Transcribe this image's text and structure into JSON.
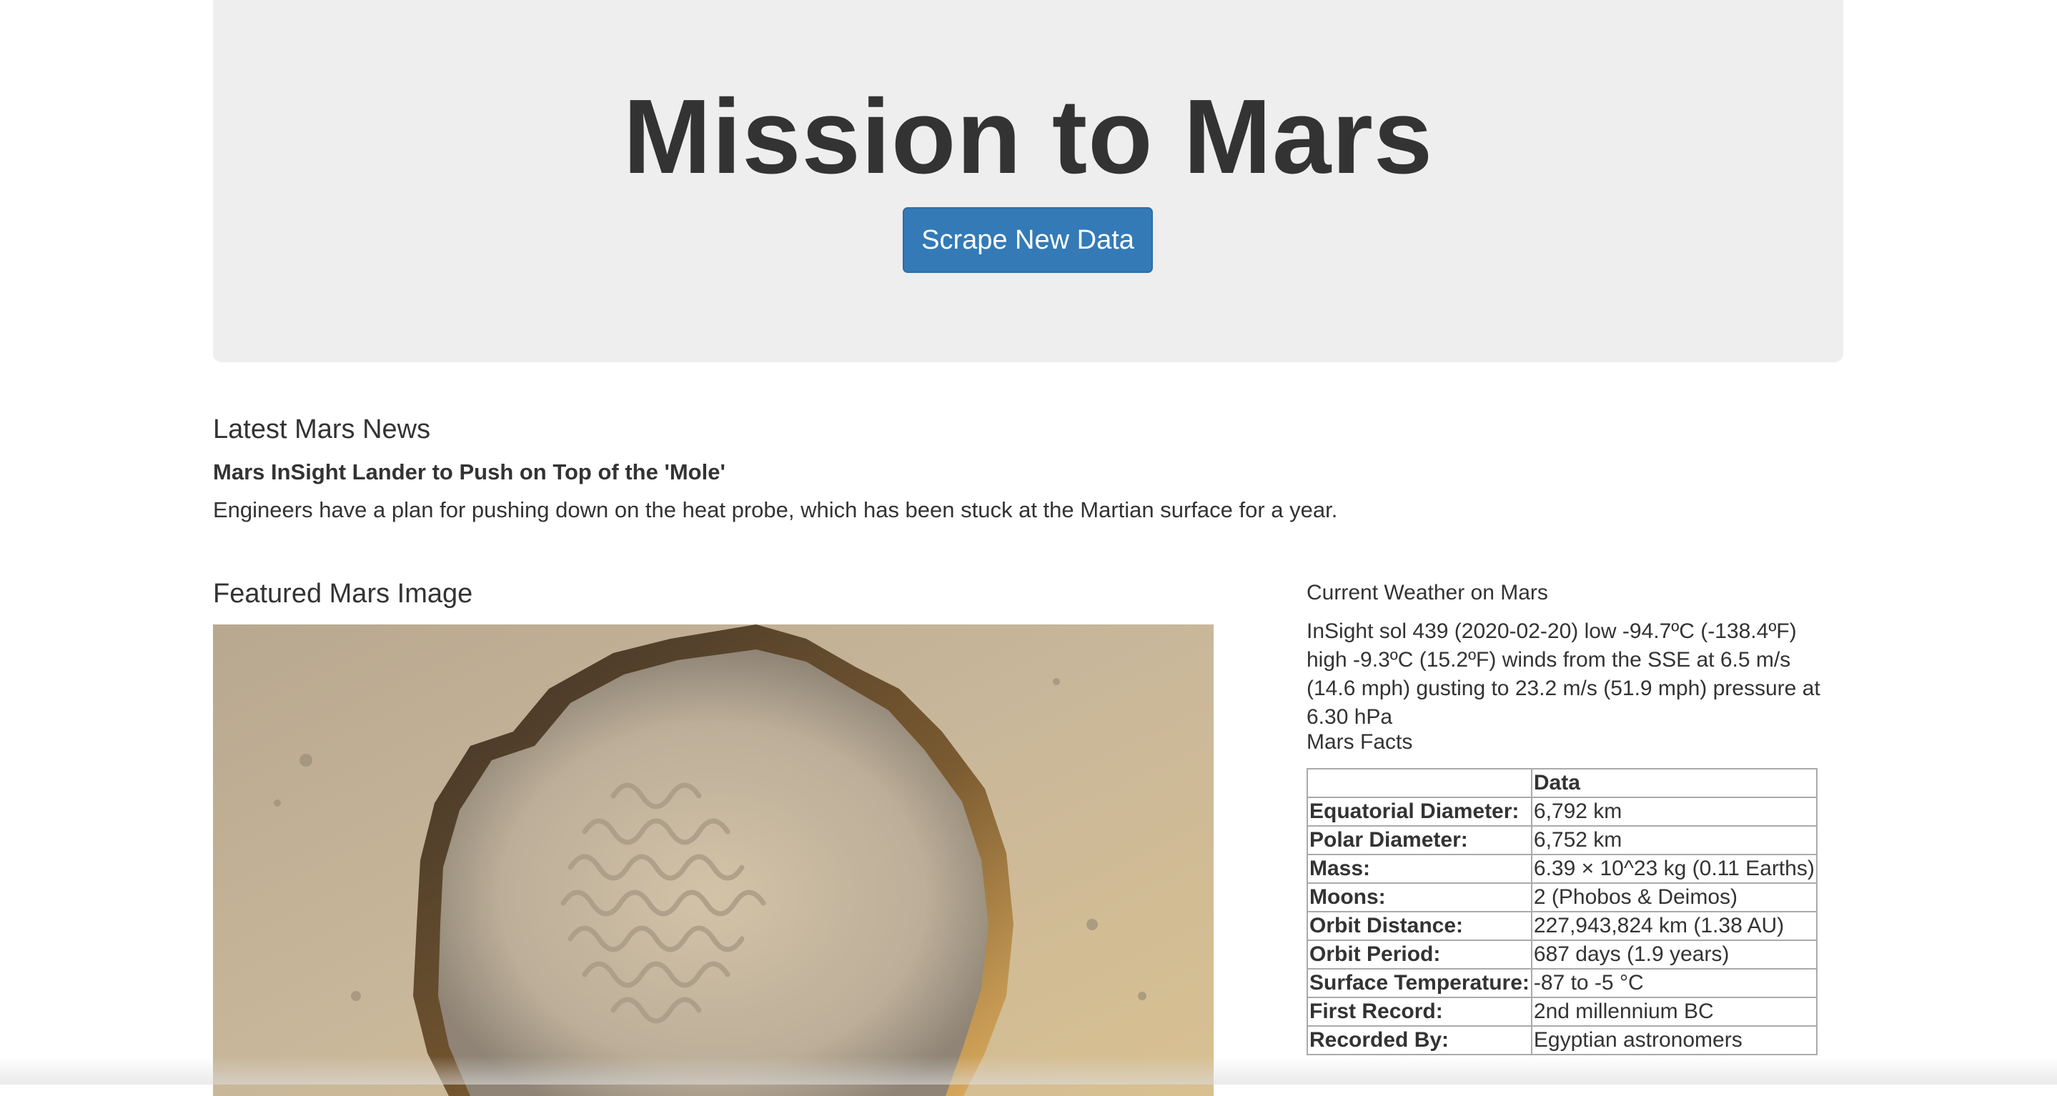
{
  "header": {
    "title": "Mission to Mars",
    "scrape_button": "Scrape New Data"
  },
  "news": {
    "heading": "Latest Mars News",
    "title": "Mars InSight Lander to Push on Top of the 'Mole'",
    "paragraph": "Engineers have a plan for pushing down on the heat probe, which has been stuck at the Martian surface for a year."
  },
  "featured_image": {
    "heading": "Featured Mars Image"
  },
  "weather": {
    "heading": "Current Weather on Mars",
    "text": "InSight sol 439 (2020-02-20) low -94.7ºC (-138.4ºF) high -9.3ºC (15.2ºF) winds from the SSE at 6.5 m/s (14.6 mph) gusting to 23.2 m/s (51.9 mph) pressure at 6.30 hPa"
  },
  "facts": {
    "heading": "Mars Facts",
    "column_header": "Data",
    "rows": [
      {
        "label": "Equatorial Diameter:",
        "value": "6,792 km"
      },
      {
        "label": "Polar Diameter:",
        "value": "6,752 km"
      },
      {
        "label": "Mass:",
        "value": "6.39 × 10^23 kg (0.11 Earths)"
      },
      {
        "label": "Moons:",
        "value": "2 (Phobos & Deimos)"
      },
      {
        "label": "Orbit Distance:",
        "value": "227,943,824 km (1.38 AU)"
      },
      {
        "label": "Orbit Period:",
        "value": "687 days (1.9 years)"
      },
      {
        "label": "Surface Temperature:",
        "value": "-87 to -5 °C"
      },
      {
        "label": "First Record:",
        "value": "2nd millennium BC"
      },
      {
        "label": "Recorded By:",
        "value": "Egyptian astronomers"
      }
    ]
  }
}
